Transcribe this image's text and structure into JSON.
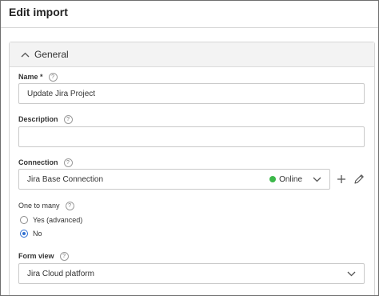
{
  "page": {
    "title": "Edit import"
  },
  "section": {
    "title": "General"
  },
  "fields": {
    "name": {
      "label": "Name *",
      "value": "Update Jira Project"
    },
    "description": {
      "label": "Description",
      "value": ""
    },
    "connection": {
      "label": "Connection",
      "value": "Jira Base Connection",
      "status": "Online",
      "status_color": "#3cb84a"
    },
    "one_to_many": {
      "label": "One to many",
      "options": [
        {
          "label": "Yes (advanced)",
          "checked": false
        },
        {
          "label": "No",
          "checked": true
        }
      ]
    },
    "form_view": {
      "label": "Form view",
      "value": "Jira Cloud platform"
    }
  },
  "help_glyph": "?",
  "icons": {
    "collapse": "chevron-up-icon",
    "dropdown": "chevron-down-icon",
    "add": "plus-icon",
    "edit": "pencil-icon",
    "help": "help-icon"
  },
  "colors": {
    "accent": "#2f6fd1",
    "online": "#3cb84a"
  }
}
